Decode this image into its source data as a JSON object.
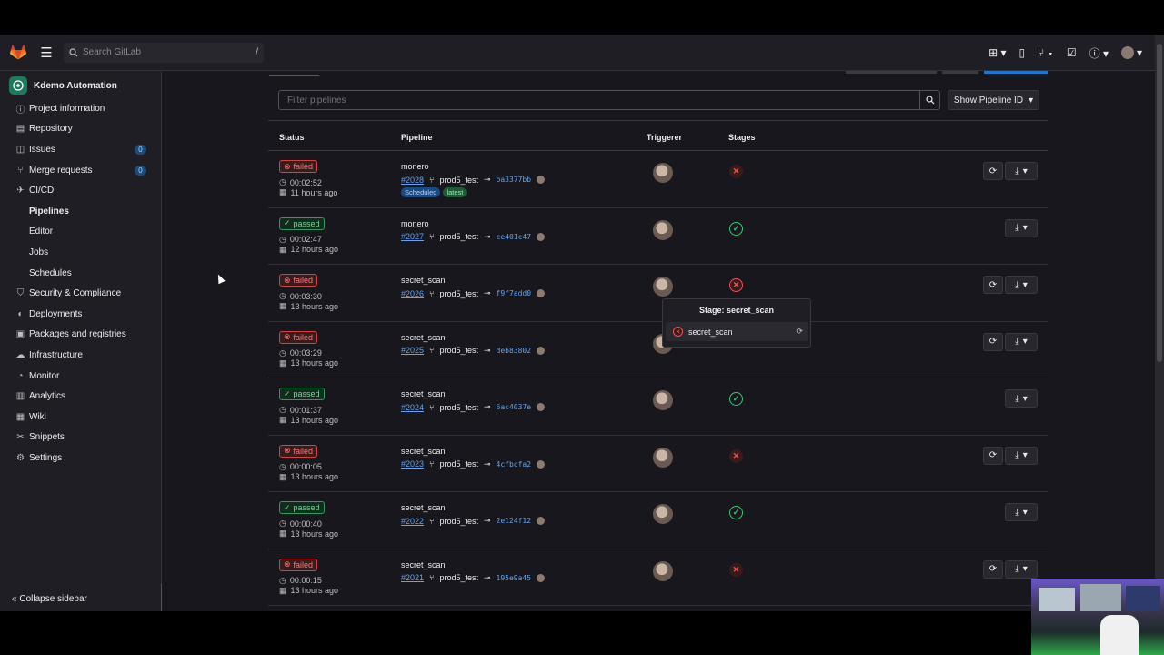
{
  "topbar": {
    "search_placeholder": "Search GitLab",
    "search_shortcut": "/"
  },
  "sidebar": {
    "project_name": "Kdemo Automation",
    "items": [
      {
        "label": "Project information",
        "icon": "info-icon"
      },
      {
        "label": "Repository",
        "icon": "doc-icon"
      },
      {
        "label": "Issues",
        "icon": "issues-icon",
        "badge": "0"
      },
      {
        "label": "Merge requests",
        "icon": "merge-icon",
        "badge": "0"
      },
      {
        "label": "CI/CD",
        "icon": "rocket-icon"
      }
    ],
    "cicd_sub": [
      "Pipelines",
      "Editor",
      "Jobs",
      "Schedules"
    ],
    "items_after": [
      {
        "label": "Security & Compliance",
        "icon": "shield-icon"
      },
      {
        "label": "Deployments",
        "icon": "deploy-icon"
      },
      {
        "label": "Packages and registries",
        "icon": "package-icon"
      },
      {
        "label": "Infrastructure",
        "icon": "cloud-icon"
      },
      {
        "label": "Monitor",
        "icon": "monitor-icon"
      },
      {
        "label": "Analytics",
        "icon": "chart-icon"
      },
      {
        "label": "Wiki",
        "icon": "book-icon"
      },
      {
        "label": "Snippets",
        "icon": "snippet-icon"
      },
      {
        "label": "Settings",
        "icon": "gear-icon"
      }
    ],
    "collapse_label": "Collapse sidebar"
  },
  "filter": {
    "placeholder": "Filter pipelines",
    "show_pipeline_id": "Show Pipeline ID"
  },
  "table": {
    "headers": [
      "Status",
      "Pipeline",
      "Triggerer",
      "Stages"
    ],
    "rows": [
      {
        "status": "failed",
        "duration": "00:02:52",
        "ago": "11 hours ago",
        "name": "monero",
        "id": "#2028",
        "ref": "prod5_test",
        "sha": "ba3377bb",
        "tags": [
          "Scheduled",
          "latest"
        ],
        "stage": "failed",
        "retry": true
      },
      {
        "status": "passed",
        "duration": "00:02:47",
        "ago": "12 hours ago",
        "name": "monero",
        "id": "#2027",
        "ref": "prod5_test",
        "sha": "ce401c47",
        "tags": [],
        "stage": "passed",
        "retry": false
      },
      {
        "status": "failed",
        "duration": "00:03:30",
        "ago": "13 hours ago",
        "name": "secret_scan",
        "id": "#2026",
        "ref": "prod5_test",
        "sha": "f9f7add0",
        "tags": [],
        "stage": "failed-active",
        "retry": true
      },
      {
        "status": "failed",
        "duration": "00:03:29",
        "ago": "13 hours ago",
        "name": "secret_scan",
        "id": "#2025",
        "ref": "prod5_test",
        "sha": "deb83802",
        "tags": [],
        "stage": "hidden",
        "retry": true
      },
      {
        "status": "passed",
        "duration": "00:01:37",
        "ago": "13 hours ago",
        "name": "secret_scan",
        "id": "#2024",
        "ref": "prod5_test",
        "sha": "6ac4037e",
        "tags": [],
        "stage": "passed",
        "retry": false
      },
      {
        "status": "failed",
        "duration": "00:00:05",
        "ago": "13 hours ago",
        "name": "secret_scan",
        "id": "#2023",
        "ref": "prod5_test",
        "sha": "4cfbcfa2",
        "tags": [],
        "stage": "failed",
        "retry": true
      },
      {
        "status": "passed",
        "duration": "00:00:40",
        "ago": "13 hours ago",
        "name": "secret_scan",
        "id": "#2022",
        "ref": "prod5_test",
        "sha": "2e124f12",
        "tags": [],
        "stage": "passed",
        "retry": false
      },
      {
        "status": "failed",
        "duration": "00:00:15",
        "ago": "13 hours ago",
        "name": "secret_scan",
        "id": "#2021",
        "ref": "prod5_test",
        "sha": "195e9a45",
        "tags": [],
        "stage": "failed",
        "retry": true
      }
    ]
  },
  "popover": {
    "title": "Stage: secret_scan",
    "job": "secret_scan"
  },
  "colors": {
    "failed": "#f05555",
    "passed": "#2ecc71",
    "link": "#64a2ee"
  }
}
